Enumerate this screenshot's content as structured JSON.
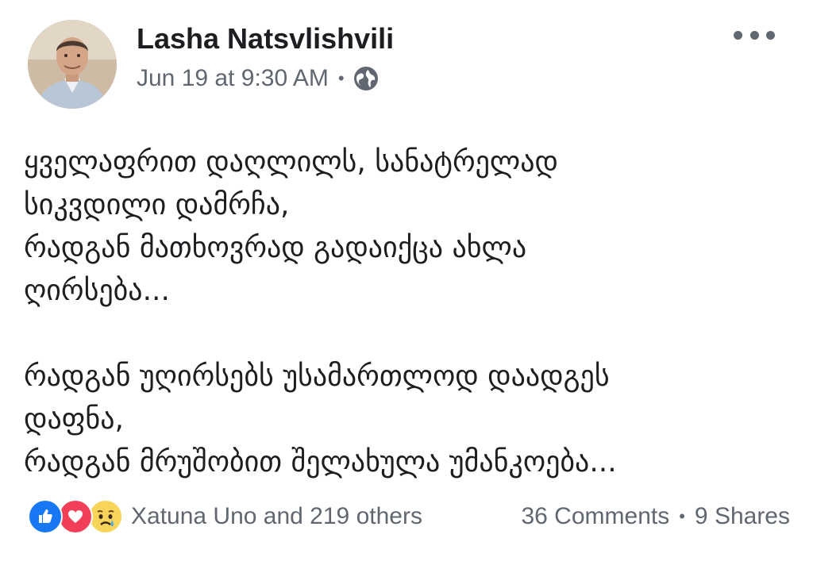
{
  "post": {
    "author": "Lasha Natsvlishvili",
    "timestamp": "Jun 19 at 9:30 AM",
    "separator": "•",
    "audience_icon": "globe-icon",
    "menu_icon": "more-options-icon",
    "body": {
      "paragraph1": [
        "ყველაფრით დაღლილს, სანატრელად",
        "სიკვდილი დამრჩა,",
        "რადგან მათხოვრად გადაიქცა ახლა",
        "ღირსება..."
      ],
      "paragraph2": [
        "რადგან უღირსებს უსამართლოდ დაადგეს",
        "დაფნა,",
        "რადგან მრუშობით შელახულა უმანკოება..."
      ]
    },
    "footer": {
      "reaction_icons": [
        "like-icon",
        "love-icon",
        "sad-icon"
      ],
      "reactors": "Xatuna Uno and 219 others",
      "comments": "36 Comments",
      "separator": "•",
      "shares": "9 Shares"
    }
  },
  "colors": {
    "text": "#1c1e21",
    "secondary": "#606770",
    "like": "#1877f2",
    "love": "#f33e58",
    "sad": "#f7d55a"
  }
}
